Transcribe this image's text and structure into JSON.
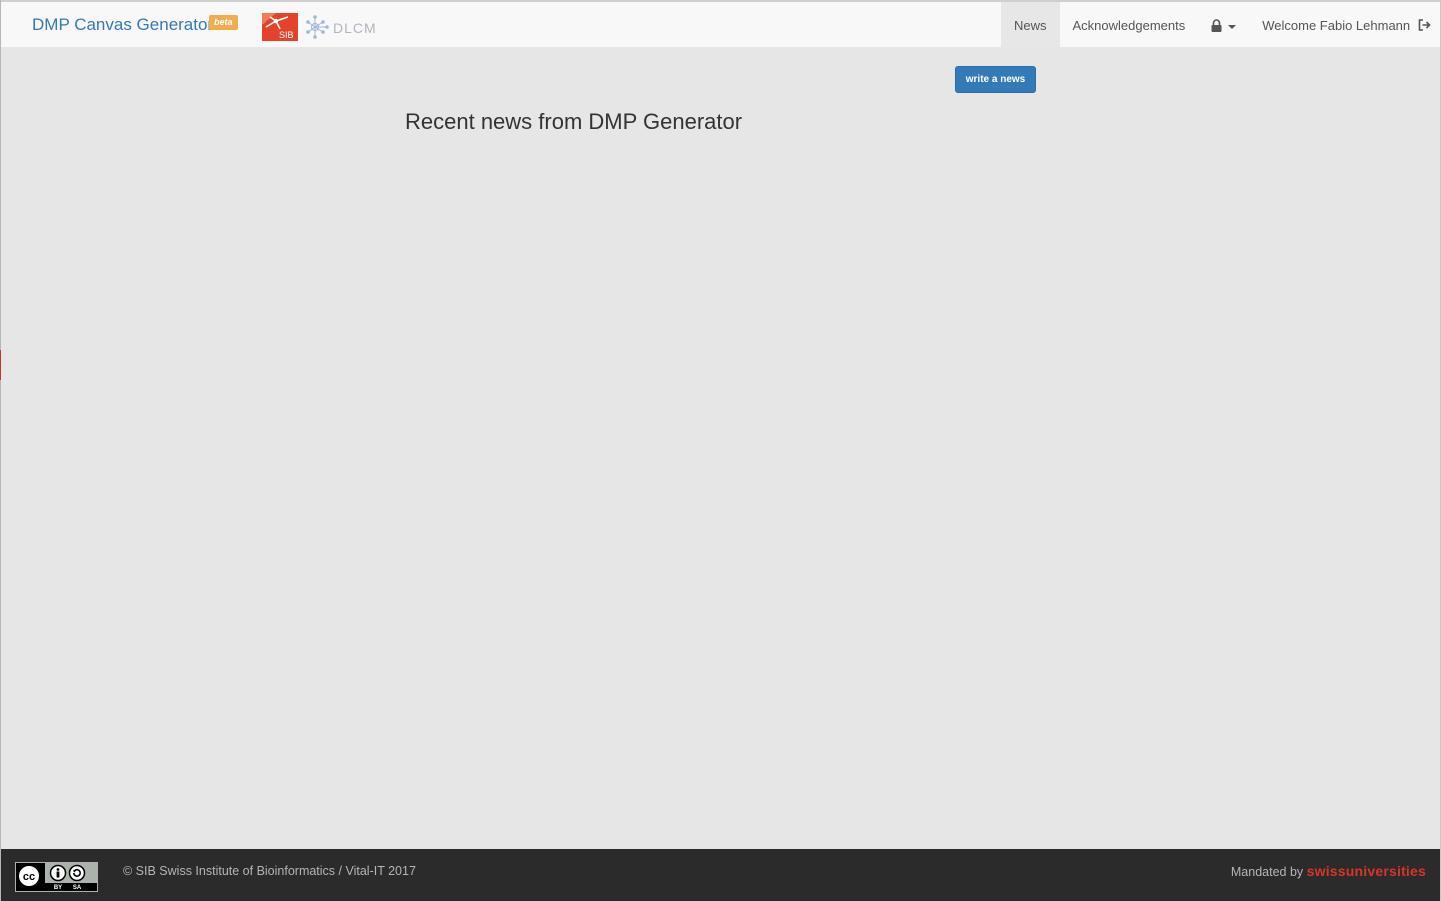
{
  "navbar": {
    "brand": "DMP Canvas Generator",
    "badge": "beta",
    "sib_logo_text": "SIB",
    "dlcm_logo_text": "DLCM",
    "items": [
      {
        "label": "News",
        "active": true
      },
      {
        "label": "Acknowledgements",
        "active": false
      }
    ],
    "lock_menu_icon": "lock-icon",
    "welcome": "Welcome Fabio Lehmann",
    "logout_icon": "logout-icon"
  },
  "main": {
    "write_button": "write a news",
    "title": "Recent news from DMP Generator"
  },
  "footer": {
    "license_badge": {
      "cc": "cc",
      "by": "BY",
      "sa": "SA"
    },
    "copyright": "© SIB Swiss Institute of Bioinformatics / Vital-IT 2017",
    "mandated_prefix": "Mandated by",
    "mandated_brand": "swissuniversities"
  },
  "colors": {
    "accent": "#337ab7",
    "badge": "#f0ad4e",
    "sib_red": "#e2432a",
    "swissuni_red": "#d9342b",
    "footer_bg": "#2b2b2b",
    "page_bg": "#e6e6e6"
  }
}
